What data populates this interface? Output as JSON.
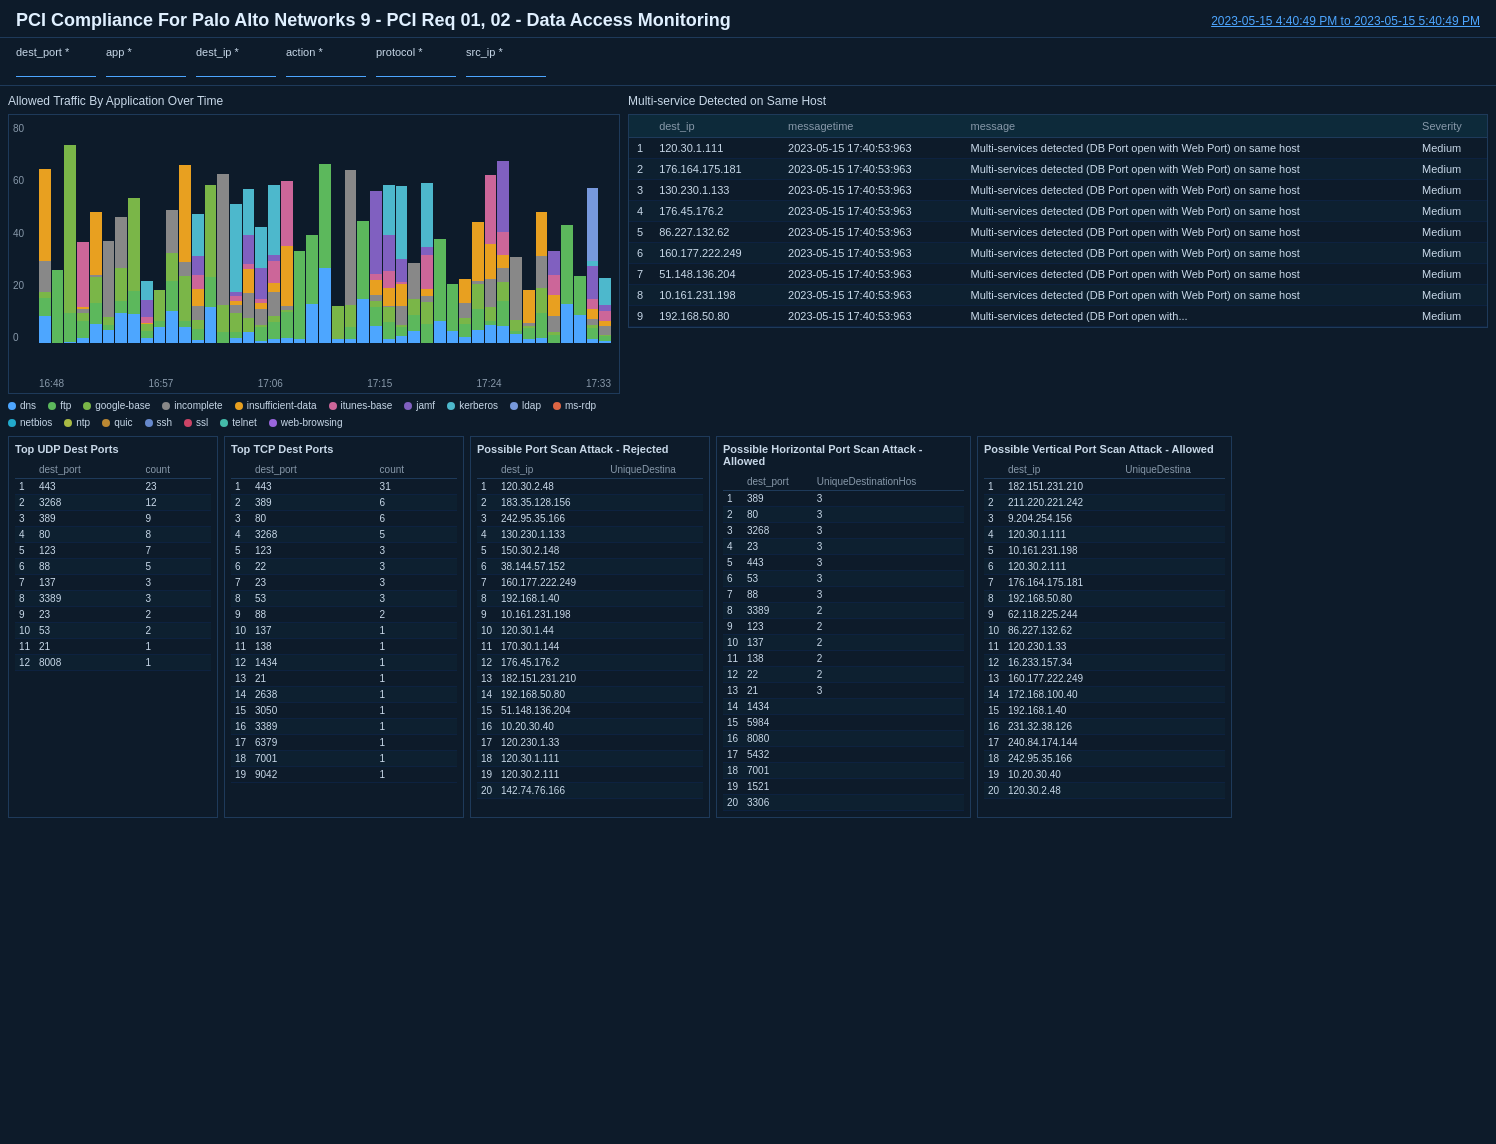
{
  "header": {
    "title": "PCI Compliance For Palo Alto Networks 9 - PCI Req 01, 02 - Data Access Monitoring",
    "time_range": "2023-05-15 4:40:49 PM to 2023-05-15 5:40:49 PM"
  },
  "filters": [
    {
      "name": "dest_port",
      "label": "dest_port *",
      "value": ""
    },
    {
      "name": "app",
      "label": "app *",
      "value": ""
    },
    {
      "name": "dest_ip",
      "label": "dest_ip *",
      "value": ""
    },
    {
      "name": "action",
      "label": "action *",
      "value": ""
    },
    {
      "name": "protocol",
      "label": "protocol *",
      "value": ""
    },
    {
      "name": "src_ip",
      "label": "src_ip *",
      "value": ""
    }
  ],
  "chart": {
    "title": "Allowed Traffic By Application Over Time",
    "y_labels": [
      "80",
      "60",
      "40",
      "20",
      "0"
    ],
    "x_labels": [
      "16:48",
      "16:57",
      "17:06",
      "17:15",
      "17:24",
      "17:33"
    ],
    "legend": [
      {
        "label": "dns",
        "color": "#4da6ff"
      },
      {
        "label": "ftp",
        "color": "#5cb85c"
      },
      {
        "label": "google-base",
        "color": "#7ab648"
      },
      {
        "label": "incomplete",
        "color": "#888"
      },
      {
        "label": "insufficient-data",
        "color": "#e8a020"
      },
      {
        "label": "itunes-base",
        "color": "#cc6699"
      },
      {
        "label": "jamf",
        "color": "#8060c0"
      },
      {
        "label": "kerberos",
        "color": "#4db8cc"
      },
      {
        "label": "ldap",
        "color": "#7799dd"
      },
      {
        "label": "ms-rdp",
        "color": "#dd6644"
      },
      {
        "label": "netbios",
        "color": "#22aacc"
      },
      {
        "label": "ntp",
        "color": "#aabb44"
      },
      {
        "label": "quic",
        "color": "#bb8833"
      },
      {
        "label": "ssh",
        "color": "#6688cc"
      },
      {
        "label": "ssl",
        "color": "#cc4466"
      },
      {
        "label": "telnet",
        "color": "#44bbaa"
      },
      {
        "label": "web-browsing",
        "color": "#9966dd"
      }
    ]
  },
  "multi_service": {
    "title": "Multi-service Detected on Same Host",
    "columns": [
      "dest_ip",
      "messagetime",
      "message",
      "Severity"
    ],
    "rows": [
      [
        "120.30.1.111",
        "2023-05-15 17:40:53:963",
        "Multi-services detected (DB Port open with Web Port) on same host",
        "Medium"
      ],
      [
        "176.164.175.181",
        "2023-05-15 17:40:53:963",
        "Multi-services detected (DB Port open with Web Port) on same host",
        "Medium"
      ],
      [
        "130.230.1.133",
        "2023-05-15 17:40:53:963",
        "Multi-services detected (DB Port open with Web Port) on same host",
        "Medium"
      ],
      [
        "176.45.176.2",
        "2023-05-15 17:40:53:963",
        "Multi-services detected (DB Port open with Web Port) on same host",
        "Medium"
      ],
      [
        "86.227.132.62",
        "2023-05-15 17:40:53:963",
        "Multi-services detected (DB Port open with Web Port) on same host",
        "Medium"
      ],
      [
        "160.177.222.249",
        "2023-05-15 17:40:53:963",
        "Multi-services detected (DB Port open with Web Port) on same host",
        "Medium"
      ],
      [
        "51.148.136.204",
        "2023-05-15 17:40:53:963",
        "Multi-services detected (DB Port open with Web Port) on same host",
        "Medium"
      ],
      [
        "10.161.231.198",
        "2023-05-15 17:40:53:963",
        "Multi-services detected (DB Port open with Web Port) on same host",
        "Medium"
      ],
      [
        "192.168.50.80",
        "2023-05-15 17:40:53:963",
        "Multi-services detected (DB Port open with...",
        "Medium"
      ]
    ]
  },
  "udp_dest_ports": {
    "title": "Top UDP Dest Ports",
    "columns": [
      "dest_port",
      "count"
    ],
    "rows": [
      [
        "443",
        "23"
      ],
      [
        "3268",
        "12"
      ],
      [
        "389",
        "9"
      ],
      [
        "80",
        "8"
      ],
      [
        "123",
        "7"
      ],
      [
        "88",
        "5"
      ],
      [
        "137",
        "3"
      ],
      [
        "3389",
        "3"
      ],
      [
        "23",
        "2"
      ],
      [
        "53",
        "2"
      ],
      [
        "21",
        "1"
      ],
      [
        "8008",
        "1"
      ]
    ]
  },
  "tcp_dest_ports": {
    "title": "Top TCP Dest Ports",
    "columns": [
      "dest_port",
      "count"
    ],
    "rows": [
      [
        "443",
        "31"
      ],
      [
        "389",
        "6"
      ],
      [
        "80",
        "6"
      ],
      [
        "3268",
        "5"
      ],
      [
        "123",
        "3"
      ],
      [
        "22",
        "3"
      ],
      [
        "23",
        "3"
      ],
      [
        "53",
        "3"
      ],
      [
        "88",
        "2"
      ],
      [
        "137",
        "1"
      ],
      [
        "138",
        "1"
      ],
      [
        "1434",
        "1"
      ],
      [
        "21",
        "1"
      ],
      [
        "2638",
        "1"
      ],
      [
        "3050",
        "1"
      ],
      [
        "3389",
        "1"
      ],
      [
        "6379",
        "1"
      ],
      [
        "7001",
        "1"
      ],
      [
        "9042",
        "1"
      ]
    ]
  },
  "port_scan_rejected": {
    "title": "Possible Port Scan Attack - Rejected",
    "columns": [
      "dest_ip",
      "UniqueDestina"
    ],
    "rows": [
      [
        "120.30.2.48",
        ""
      ],
      [
        "183.35.128.156",
        ""
      ],
      [
        "242.95.35.166",
        ""
      ],
      [
        "130.230.1.133",
        ""
      ],
      [
        "150.30.2.148",
        ""
      ],
      [
        "38.144.57.152",
        ""
      ],
      [
        "160.177.222.249",
        ""
      ],
      [
        "192.168.1.40",
        ""
      ],
      [
        "10.161.231.198",
        ""
      ],
      [
        "120.30.1.44",
        ""
      ],
      [
        "170.30.1.144",
        ""
      ],
      [
        "176.45.176.2",
        ""
      ],
      [
        "182.151.231.210",
        ""
      ],
      [
        "192.168.50.80",
        ""
      ],
      [
        "51.148.136.204",
        ""
      ],
      [
        "10.20.30.40",
        ""
      ],
      [
        "120.230.1.33",
        ""
      ],
      [
        "120.30.1.111",
        ""
      ],
      [
        "120.30.2.111",
        ""
      ],
      [
        "142.74.76.166",
        ""
      ]
    ]
  },
  "horiz_port_scan": {
    "title": "Possible Horizontal Port Scan Attack - Allowed",
    "columns": [
      "dest_port",
      "UniqueDestinationHos"
    ],
    "rows": [
      [
        "389",
        "3"
      ],
      [
        "80",
        "3"
      ],
      [
        "3268",
        "3"
      ],
      [
        "23",
        "3"
      ],
      [
        "443",
        "3"
      ],
      [
        "53",
        "3"
      ],
      [
        "88",
        "3"
      ],
      [
        "3389",
        "2"
      ],
      [
        "123",
        "2"
      ],
      [
        "137",
        "2"
      ],
      [
        "138",
        "2"
      ],
      [
        "22",
        "2"
      ],
      [
        "21",
        "3"
      ],
      [
        "1434",
        ""
      ],
      [
        "5984",
        ""
      ],
      [
        "8080",
        ""
      ],
      [
        "5432",
        ""
      ],
      [
        "7001",
        ""
      ],
      [
        "1521",
        ""
      ],
      [
        "3306",
        ""
      ]
    ]
  },
  "vert_port_scan": {
    "title": "Possible Vertical Port Scan Attack - Allowed",
    "columns": [
      "dest_ip",
      "UniqueDestina"
    ],
    "rows": [
      [
        "182.151.231.210",
        ""
      ],
      [
        "211.220.221.242",
        ""
      ],
      [
        "9.204.254.156",
        ""
      ],
      [
        "120.30.1.111",
        ""
      ],
      [
        "10.161.231.198",
        ""
      ],
      [
        "120.30.2.111",
        ""
      ],
      [
        "176.164.175.181",
        ""
      ],
      [
        "192.168.50.80",
        ""
      ],
      [
        "62.118.225.244",
        ""
      ],
      [
        "86.227.132.62",
        ""
      ],
      [
        "120.230.1.33",
        ""
      ],
      [
        "16.233.157.34",
        ""
      ],
      [
        "160.177.222.249",
        ""
      ],
      [
        "172.168.100.40",
        ""
      ],
      [
        "192.168.1.40",
        ""
      ],
      [
        "231.32.38.126",
        ""
      ],
      [
        "240.84.174.144",
        ""
      ],
      [
        "242.95.35.166",
        ""
      ],
      [
        "10.20.30.40",
        ""
      ],
      [
        "120.30.2.48",
        ""
      ]
    ]
  }
}
